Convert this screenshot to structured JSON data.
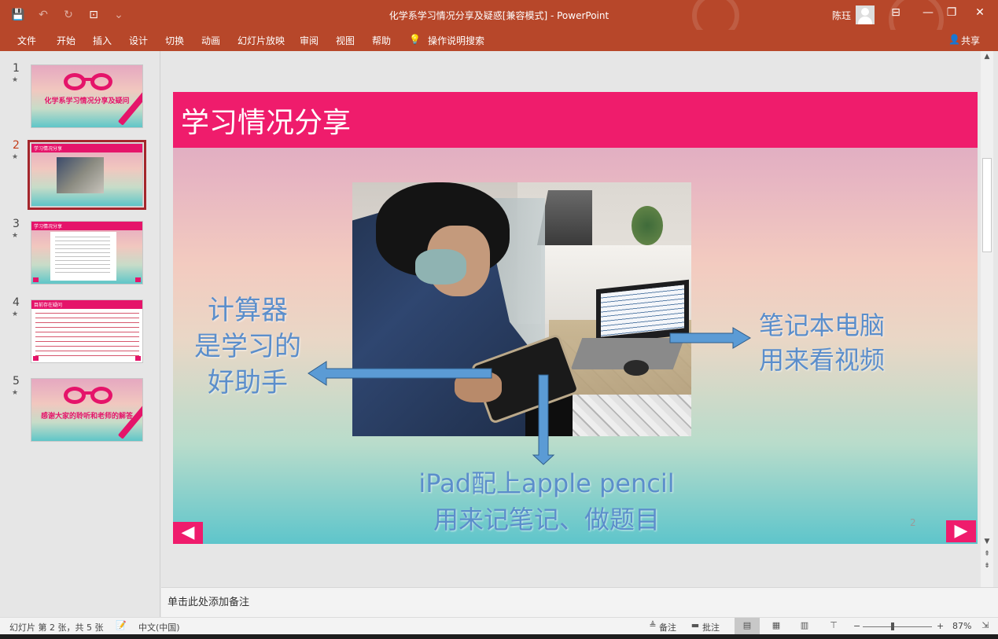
{
  "window": {
    "title": "化学系学习情况分享及疑惑[兼容模式]  -  PowerPoint",
    "user_name": "陈珏",
    "qat": {
      "save": "💾",
      "undo": "↶",
      "redo": "↻",
      "present": "⊡",
      "more": "⌄"
    },
    "controls": {
      "ribbon_options": "⊟",
      "minimize": "—",
      "restore": "❐",
      "close": "✕"
    }
  },
  "menu": {
    "items": [
      "文件",
      "开始",
      "插入",
      "设计",
      "切换",
      "动画",
      "幻灯片放映",
      "审阅",
      "视图",
      "帮助",
      "操作说明搜索"
    ],
    "search_icon": "💡",
    "share_label": "共享",
    "share_icon": "👤"
  },
  "thumbnails": [
    {
      "num": "1",
      "title": "化学系学习情况分享及疑问",
      "subtitle": ""
    },
    {
      "num": "2",
      "title": "学习情况分享"
    },
    {
      "num": "3",
      "title": "学习情况分享"
    },
    {
      "num": "4",
      "title": "目前存在疑问"
    },
    {
      "num": "5",
      "title": "感谢大家的聆听和老师的解答"
    }
  ],
  "thumb_star": "★",
  "slide": {
    "title": "学习情况分享",
    "left_callout": [
      "计算器",
      "是学习的",
      "好助手"
    ],
    "right_callout": [
      "笔记本电脑",
      "用来看视频"
    ],
    "bottom_callout": [
      "iPad配上apple pencil",
      "用来记笔记、做题目"
    ],
    "page_number": "2",
    "prev_symbol": "◀",
    "next_symbol": "▶",
    "accent_color": "#ef1c6c",
    "callout_color": "#5b8ecb",
    "arrow_color": "#5b9bd5"
  },
  "notes": {
    "placeholder": "单击此处添加备注"
  },
  "status": {
    "slide_info": "幻灯片 第 2 张，共 5 张",
    "language": "中文(中国)",
    "notes_label": "备注",
    "comments_label": "批注",
    "zoom": "87%",
    "zoom_minus": "−",
    "zoom_plus": "+"
  }
}
